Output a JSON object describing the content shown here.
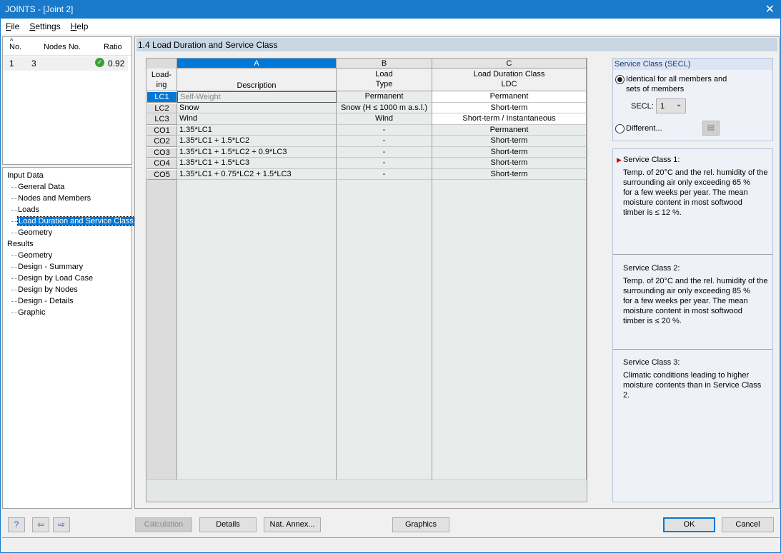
{
  "window": {
    "title": "JOINTS - [Joint 2]"
  },
  "menu": [
    {
      "label": "File",
      "key": "F",
      "rest": "ile"
    },
    {
      "label": "Settings",
      "key": "S",
      "rest": "ettings"
    },
    {
      "label": "Help",
      "key": "H",
      "rest": "elp"
    }
  ],
  "joints_table": {
    "headers": [
      "No.",
      "Nodes No.",
      "Ratio"
    ],
    "rows": [
      {
        "no": "1",
        "nodes": "3",
        "ratio": "0.92",
        "status": "ok-check-icon"
      }
    ]
  },
  "tree": {
    "input_label": "Input Data",
    "input_items": [
      "General Data",
      "Nodes and Members",
      "Loads",
      "Load Duration and Service Class",
      "Geometry"
    ],
    "selected": "Load Duration and Service Class",
    "results_label": "Results",
    "results_items": [
      "Geometry",
      "Design - Summary",
      "Design by Load Case",
      "Design by Nodes",
      "Design - Details",
      "Graphic"
    ]
  },
  "main": {
    "title": "1.4 Load Duration and Service Class"
  },
  "grid": {
    "col_letters": [
      "A",
      "B",
      "C"
    ],
    "header_loading": [
      "Load-",
      "ing"
    ],
    "header_a": "Description",
    "header_b": [
      "Load",
      "Type"
    ],
    "header_c": [
      "Load Duration Class",
      "LDC"
    ],
    "rows": [
      {
        "id": "LC1",
        "desc": "Self-Weight",
        "type": "Permanent",
        "ldc": "Permanent"
      },
      {
        "id": "LC2",
        "desc": "Snow",
        "type": "Snow (H ≤ 1000 m a.s.l.)",
        "ldc": "Short-term"
      },
      {
        "id": "LC3",
        "desc": "Wind",
        "type": "Wind",
        "ldc": "Short-term / Instantaneous"
      },
      {
        "id": "CO1",
        "desc": "1.35*LC1",
        "type": "-",
        "ldc": "Permanent"
      },
      {
        "id": "CO2",
        "desc": "1.35*LC1 + 1.5*LC2",
        "type": "-",
        "ldc": "Short-term"
      },
      {
        "id": "CO3",
        "desc": "1.35*LC1 + 1.5*LC2 + 0.9*LC3",
        "type": "-",
        "ldc": "Short-term"
      },
      {
        "id": "CO4",
        "desc": "1.35*LC1 + 1.5*LC3",
        "type": "-",
        "ldc": "Short-term"
      },
      {
        "id": "CO5",
        "desc": "1.35*LC1 + 0.75*LC2 + 1.5*LC3",
        "type": "-",
        "ldc": "Short-term"
      }
    ]
  },
  "service_class": {
    "title": "Service Class (SECL)",
    "identical_line1": "Identical for all members and",
    "identical_line2": "sets of members",
    "secl_label": "SECL:",
    "secl_value": "1",
    "different_label": "Different...",
    "selected": "identical"
  },
  "descriptions": [
    {
      "title": "Service Class 1:",
      "lines": [
        "Temp. of 20°C and the rel. humidity of the",
        "surrounding air only exceeding 65 %",
        "for a few weeks per year. The mean",
        "moisture content in most softwood",
        "timber is ≤ 12 %."
      ]
    },
    {
      "title": "Service Class 2:",
      "lines": [
        "Temp. of 20°C and the rel. humidity of the",
        "surrounding air only exceeding 85 %",
        "for a few weeks per year. The mean",
        "moisture content in most softwood",
        "timber is ≤ 20 %."
      ]
    },
    {
      "title": "Service Class 3:",
      "lines": [
        "Climatic conditions leading to higher",
        "moisture contents than in Service Class 2."
      ]
    }
  ],
  "buttons": {
    "calculation": "Calculation",
    "details": "Details",
    "nat_annex": "Nat. Annex...",
    "graphics": "Graphics",
    "ok": "OK",
    "cancel": "Cancel"
  },
  "colors": {
    "accent": "#0078d7",
    "titlebar": "#1979ca",
    "header_band": "#c9d6e3",
    "ok_green": "#3aa13a"
  }
}
